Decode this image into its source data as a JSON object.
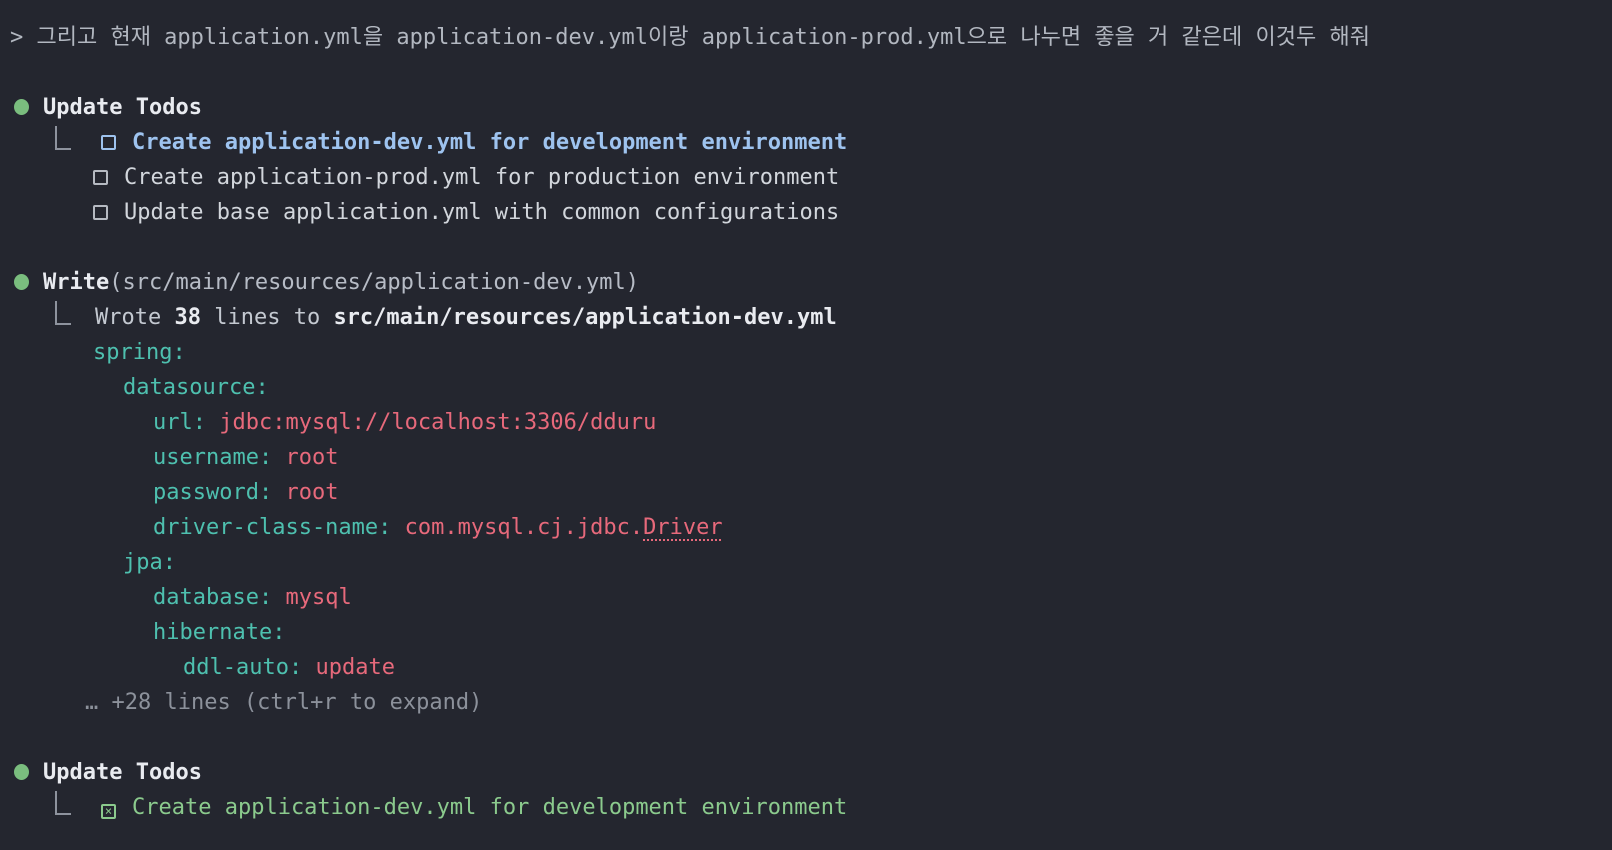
{
  "theme": {
    "colors": {
      "bg": "#24262f",
      "prompt": "#b2b7c0",
      "bright": "#e9ebf0",
      "todo": "#d2d6dc",
      "paren": "#b7bcc6",
      "result": "#c4c9d1",
      "muted": "#8e939e",
      "muted2": "#8c919b",
      "graybox": "#b6bac2",
      "green": "#7abd7e",
      "blue": "#9ec3ef",
      "teal": "#4ec0af",
      "red": "#e7697b",
      "todogreen": "#8bca8d"
    },
    "glyphs": {
      "check": "×",
      "blank": " "
    }
  },
  "terminal": {
    "lines": [
      {
        "name": "user-prompt",
        "type": "prompt",
        "indent": 10,
        "segments": [
          {
            "name": "prompt-text",
            "text": "> 그리고 현재 application.yml을 application-dev.yml이랑 application-prod.yml으로 나누면 좋을 거 같은데 이것두 해줘",
            "style": "prompt"
          }
        ]
      },
      {
        "name": "blank-line",
        "type": "blank"
      },
      {
        "name": "tool-call-update-todos",
        "type": "header",
        "indent": 14,
        "segments": [
          {
            "icon": "tool-bullet-icon",
            "style": "green"
          },
          {
            "name": "tool-name",
            "text": "Update Todos",
            "style": "bright",
            "bold": true
          }
        ]
      },
      {
        "name": "todo-item-active",
        "type": "todo-first",
        "indent": 55,
        "segments": [
          {
            "icon": "connector-icon",
            "style": "muted"
          },
          {
            "icon": "checkbox-unchecked-icon",
            "style": "blue"
          },
          {
            "name": "todo-label",
            "text": "Create application-dev.yml for development environment",
            "style": "blue",
            "bold": true
          }
        ]
      },
      {
        "name": "todo-item",
        "type": "todo",
        "indent": 93,
        "segments": [
          {
            "icon": "checkbox-unchecked-icon",
            "style": "graybox"
          },
          {
            "name": "todo-label",
            "text": "Create application-prod.yml for production environment",
            "style": "todo"
          }
        ]
      },
      {
        "name": "todo-item",
        "type": "todo",
        "indent": 93,
        "segments": [
          {
            "icon": "checkbox-unchecked-icon",
            "style": "graybox"
          },
          {
            "name": "todo-label",
            "text": "Update base application.yml with common configurations",
            "style": "todo"
          }
        ]
      },
      {
        "name": "blank-line",
        "type": "blank"
      },
      {
        "name": "tool-call-write",
        "type": "header",
        "indent": 14,
        "segments": [
          {
            "icon": "tool-bullet-icon",
            "style": "green"
          },
          {
            "name": "tool-name",
            "text": "Write",
            "style": "bright",
            "bold": true
          },
          {
            "name": "tool-args",
            "text": "(src/main/resources/application-dev.yml)",
            "style": "paren"
          }
        ]
      },
      {
        "name": "tool-result-wrote",
        "type": "result",
        "indent": 55,
        "segments": [
          {
            "icon": "connector-icon",
            "style": "muted"
          },
          {
            "name": "result-text",
            "text": "Wrote ",
            "style": "result"
          },
          {
            "name": "line-count",
            "text": "38",
            "style": "bright",
            "bold": true
          },
          {
            "name": "result-text",
            "text": " lines to ",
            "style": "result"
          },
          {
            "name": "file-path",
            "text": "src/main/resources/application-dev.yml",
            "style": "bright",
            "bold": true
          }
        ]
      },
      {
        "name": "yaml-line",
        "type": "yaml",
        "indent": 93,
        "segments": [
          {
            "name": "yaml-key",
            "text": "spring:",
            "style": "teal"
          }
        ]
      },
      {
        "name": "yaml-line",
        "type": "yaml",
        "indent": 123,
        "segments": [
          {
            "name": "yaml-key",
            "text": "datasource:",
            "style": "teal"
          }
        ]
      },
      {
        "name": "yaml-line",
        "type": "yaml",
        "indent": 153,
        "segments": [
          {
            "name": "yaml-key",
            "text": "url:",
            "style": "teal"
          },
          {
            "name": "yaml-value",
            "text": " jdbc:mysql://localhost:3306/dduru",
            "style": "red"
          }
        ]
      },
      {
        "name": "yaml-line",
        "type": "yaml",
        "indent": 153,
        "segments": [
          {
            "name": "yaml-key",
            "text": "username:",
            "style": "teal"
          },
          {
            "name": "yaml-value",
            "text": " root",
            "style": "red"
          }
        ]
      },
      {
        "name": "yaml-line",
        "type": "yaml",
        "indent": 153,
        "segments": [
          {
            "name": "yaml-key",
            "text": "password:",
            "style": "teal"
          },
          {
            "name": "yaml-value",
            "text": " root",
            "style": "red"
          }
        ]
      },
      {
        "name": "yaml-line",
        "type": "yaml",
        "indent": 153,
        "segments": [
          {
            "name": "yaml-key",
            "text": "driver-class-name:",
            "style": "teal"
          },
          {
            "name": "yaml-value",
            "text": " com.mysql.cj.jdbc.",
            "style": "red"
          },
          {
            "name": "yaml-value-misspelled",
            "text": "Driver",
            "style": "red",
            "underline": true
          }
        ]
      },
      {
        "name": "yaml-line",
        "type": "yaml",
        "indent": 123,
        "segments": [
          {
            "name": "yaml-key",
            "text": "jpa:",
            "style": "teal"
          }
        ]
      },
      {
        "name": "yaml-line",
        "type": "yaml",
        "indent": 153,
        "segments": [
          {
            "name": "yaml-key",
            "text": "database:",
            "style": "teal"
          },
          {
            "name": "yaml-value",
            "text": " mysql",
            "style": "red"
          }
        ]
      },
      {
        "name": "yaml-line",
        "type": "yaml",
        "indent": 153,
        "segments": [
          {
            "name": "yaml-key",
            "text": "hibernate:",
            "style": "teal"
          }
        ]
      },
      {
        "name": "yaml-line",
        "type": "yaml",
        "indent": 183,
        "segments": [
          {
            "name": "yaml-key",
            "text": "ddl-auto:",
            "style": "teal"
          },
          {
            "name": "yaml-value",
            "text": " update",
            "style": "red"
          }
        ]
      },
      {
        "name": "collapsed-lines-indicator",
        "type": "more",
        "indent": 85,
        "segments": [
          {
            "name": "collapsed-hint",
            "text": "… +28 lines (ctrl+r to expand)",
            "style": "muted2"
          }
        ]
      },
      {
        "name": "blank-line",
        "type": "blank"
      },
      {
        "name": "tool-call-update-todos",
        "type": "header",
        "indent": 14,
        "segments": [
          {
            "icon": "tool-bullet-icon",
            "style": "green"
          },
          {
            "name": "tool-name",
            "text": "Update Todos",
            "style": "bright",
            "bold": true
          }
        ]
      },
      {
        "name": "todo-item-completed",
        "type": "todo-first",
        "indent": 55,
        "segments": [
          {
            "icon": "connector-icon",
            "style": "muted"
          },
          {
            "icon": "checkbox-checked-icon",
            "style": "todogreen"
          },
          {
            "name": "todo-label",
            "text": "Create application-dev.yml for development environment",
            "style": "todogreen"
          }
        ]
      }
    ]
  }
}
